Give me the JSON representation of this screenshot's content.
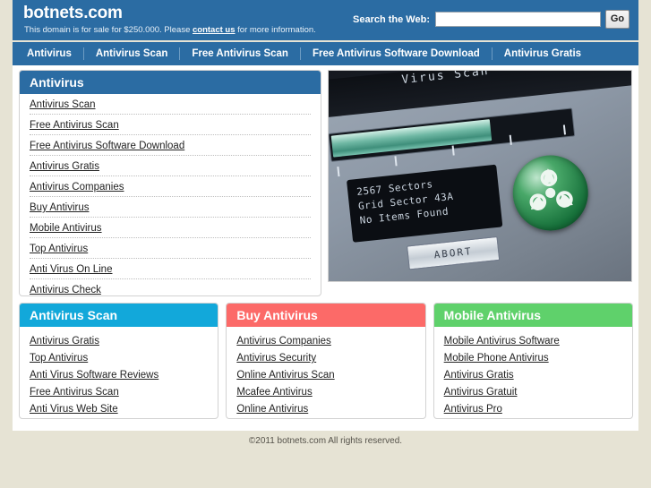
{
  "header": {
    "brand": "botnets.com",
    "tagline_before": "This domain is for sale for $250.000. Please ",
    "tagline_link": "contact us",
    "tagline_after": " for more information.",
    "search_label": "Search the Web:",
    "search_value": "",
    "search_placeholder": "",
    "go_label": "Go",
    "bg_color": "#2b6ca3"
  },
  "nav": {
    "items": [
      {
        "label": "Antivirus"
      },
      {
        "label": "Antivirus Scan"
      },
      {
        "label": "Free Antivirus Scan"
      },
      {
        "label": "Free Antivirus Software Download"
      },
      {
        "label": "Antivirus Gratis"
      }
    ]
  },
  "main_panel": {
    "title": "Antivirus",
    "header_color": "#2b6ca3",
    "links": [
      {
        "label": "Antivirus Scan"
      },
      {
        "label": "Free Antivirus Scan"
      },
      {
        "label": "Free Antivirus Software Download"
      },
      {
        "label": "Antivirus Gratis"
      },
      {
        "label": "Antivirus Companies"
      },
      {
        "label": "Buy Antivirus"
      },
      {
        "label": "Mobile Antivirus"
      },
      {
        "label": "Top Antivirus"
      },
      {
        "label": "Anti Virus On Line"
      },
      {
        "label": "Antivirus Check"
      }
    ]
  },
  "hero_image": {
    "alt": "virus scan device photo",
    "device_title": "Virus Scan",
    "lcd_line1": "2567 Sectors",
    "lcd_line2": "Grid Sector 43A",
    "lcd_line3": "No Items Found",
    "button_label": "ABORT"
  },
  "bottom_panels": [
    {
      "title": "Antivirus Scan",
      "header_color": "#12a8da",
      "links": [
        {
          "label": "Antivirus Gratis"
        },
        {
          "label": "Top Antivirus"
        },
        {
          "label": "Anti Virus Software Reviews"
        },
        {
          "label": "Free Antivirus Scan"
        },
        {
          "label": "Anti Virus Web Site"
        }
      ]
    },
    {
      "title": "Buy Antivirus",
      "header_color": "#fc6a68",
      "links": [
        {
          "label": "Antivirus Companies"
        },
        {
          "label": "Antivirus Security"
        },
        {
          "label": "Online Antivirus Scan"
        },
        {
          "label": "Mcafee Antivirus"
        },
        {
          "label": "Online Antivirus"
        }
      ]
    },
    {
      "title": "Mobile Antivirus",
      "header_color": "#5fd16b",
      "links": [
        {
          "label": "Mobile Antivirus Software"
        },
        {
          "label": "Mobile Phone Antivirus"
        },
        {
          "label": "Antivirus Gratis"
        },
        {
          "label": "Antivirus Gratuit"
        },
        {
          "label": "Antivirus Pro"
        }
      ]
    }
  ],
  "footer": {
    "copyright": "©2011 botnets.com All rights reserved."
  }
}
